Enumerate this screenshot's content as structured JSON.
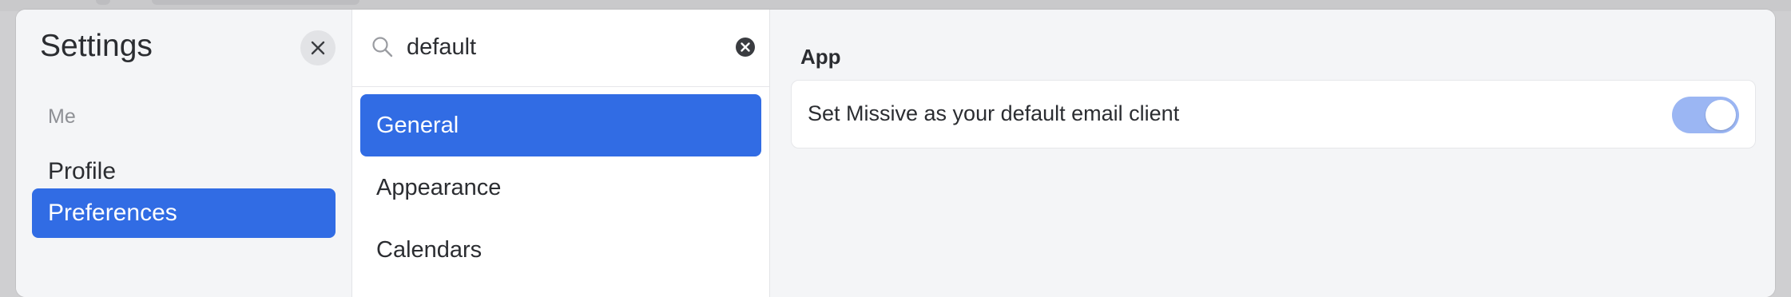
{
  "sidebar": {
    "title": "Settings",
    "section_label": "Me",
    "items": [
      {
        "label": "Profile",
        "active": false
      },
      {
        "label": "Preferences",
        "active": true
      }
    ]
  },
  "search": {
    "value": "default",
    "placeholder": ""
  },
  "categories": [
    {
      "label": "General",
      "active": true
    },
    {
      "label": "Appearance",
      "active": false
    },
    {
      "label": "Calendars",
      "active": false
    }
  ],
  "content": {
    "group_label": "App",
    "setting": {
      "label": "Set Missive as your default email client",
      "toggle_on": true
    }
  },
  "colors": {
    "accent": "#316ce4",
    "toggle_track": "#9bb6f3",
    "panel_bg": "#f4f5f7"
  },
  "icons": {
    "close": "close-icon",
    "search": "search-icon",
    "clear": "clear-icon"
  }
}
